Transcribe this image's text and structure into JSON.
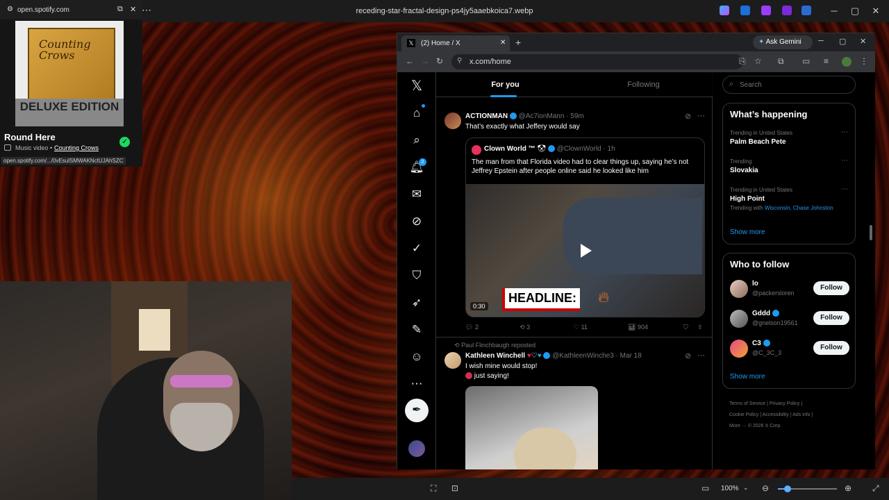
{
  "viewer": {
    "title": "receding-star-fractal-design-ps4jy5aaebkoica7.webp",
    "zoom": "100%",
    "menu_icon": "more-icon"
  },
  "spotify": {
    "site": "open.spotify.com",
    "album_text_top": "Counting Crows",
    "album_text_bottom": "DELUXE EDITION",
    "track": "Round Here",
    "type": "Music video",
    "artist": "Counting Crows",
    "link": "open.spotify.com/.../0vEsulSMWAKNctUJAhSZC"
  },
  "browser": {
    "tab_title": "(2) Home / X",
    "url": "x.com/home",
    "gemini": "Ask Gemini"
  },
  "x": {
    "tabs": [
      "For you",
      "Following"
    ],
    "notification_count": "2",
    "search_placeholder": "Search",
    "post1": {
      "name": "ACTIONMAN",
      "handle": "@Ac7ionMann",
      "time": "· 59m",
      "text": "That’s exactly what Jeffery would say",
      "quote_name": "Clown World ™",
      "quote_handle": "@ClownWorld",
      "quote_time": "· 1h",
      "quote_text": "The man from that Florida video had to clear things up, saying he’s not Jeffrey Epstein after people online said he looked like him",
      "video_time": "0:30",
      "headline": "HEADLINE:",
      "replies": "2",
      "reposts": "3",
      "likes": "11",
      "views": "904"
    },
    "post2": {
      "reposted_by": "Paul Flinchbaugh reposted",
      "name": "Kathleen Winchell",
      "handle": "@KathleenWinche3",
      "time": "· Mar 18",
      "text1": "I wish mine would stop!",
      "text2": "just saying!"
    },
    "trends_title": "What’s happening",
    "trends": [
      {
        "context": "Trending in United States",
        "name": "Palm Beach Pete",
        "extra": ""
      },
      {
        "context": "Trending",
        "name": "Slovakia",
        "extra": ""
      },
      {
        "context": "Trending in United States",
        "name": "High Point",
        "extra": "Trending with",
        "links": "Wisconsin, Chase Johnston"
      }
    ],
    "show_more": "Show more",
    "who_title": "Who to follow",
    "follow": [
      {
        "name": "lo",
        "handle": "@packersloren"
      },
      {
        "name": "Gddd",
        "handle": "@gnelson19561"
      },
      {
        "name": "C3",
        "handle": "@C_3C_3"
      }
    ],
    "follow_label": "Follow",
    "footer": [
      "Terms of Service",
      "Privacy Policy",
      "Cookie Policy",
      "Accessibility",
      "Ads info",
      "More ···",
      "© 2026 X Corp."
    ]
  }
}
